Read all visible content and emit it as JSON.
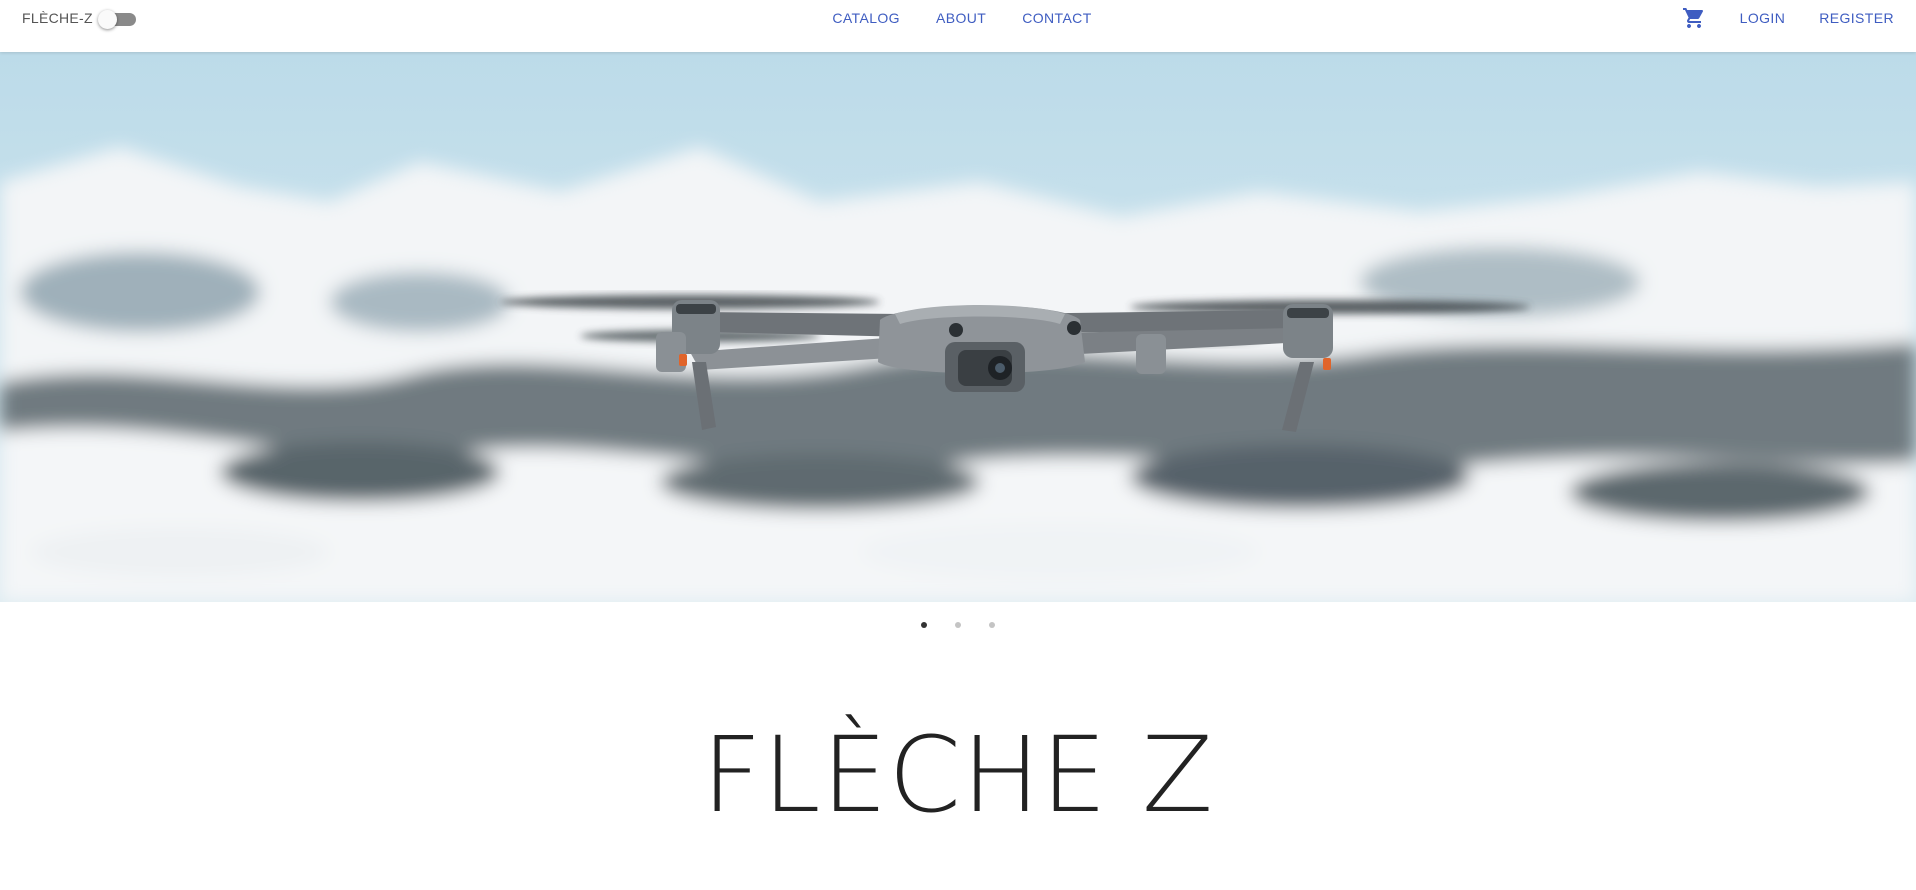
{
  "header": {
    "brand": "FLÈCHE-Z",
    "theme_toggle": {
      "on": false
    },
    "nav": [
      {
        "label": "CATALOG"
      },
      {
        "label": "ABOUT"
      },
      {
        "label": "CONTACT"
      }
    ],
    "cart_icon": "shopping-cart-icon",
    "login_label": "LOGIN",
    "register_label": "REGISTER"
  },
  "hero": {
    "image": "drone-over-snowy-mountains",
    "slides": 3,
    "active_slide": 1
  },
  "title": "FLÈCHE Z",
  "colors": {
    "link": "#3f5dc1",
    "title": "#222222",
    "brand": "#555555"
  }
}
